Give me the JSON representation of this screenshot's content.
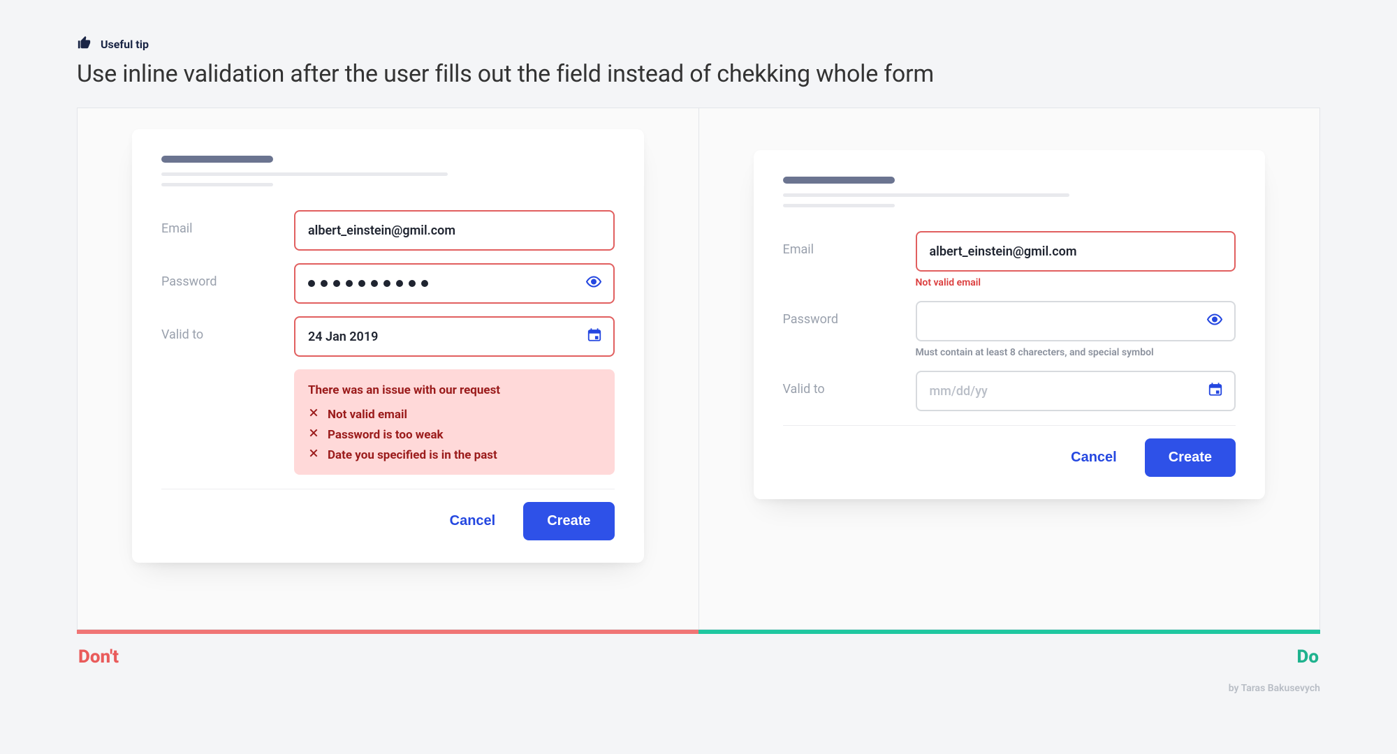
{
  "tip": {
    "label": "Useful tip"
  },
  "headline": "Use inline validation after the user fills out the field instead of chekking whole form",
  "form": {
    "labels": {
      "email": "Email",
      "password": "Password",
      "valid_to": "Valid to"
    },
    "buttons": {
      "cancel": "Cancel",
      "create": "Create"
    }
  },
  "dont": {
    "email": "albert_einstein@gmil.com",
    "valid_to": "24 Jan 2019",
    "error_title": "There was an issue with our request",
    "errors": [
      "Not valid email",
      "Password is too weak",
      "Date you specified is in the past"
    ]
  },
  "do": {
    "email": "albert_einstein@gmil.com",
    "email_error": "Not valid email",
    "password_help": "Must contain at least 8 charecters, and special symbol",
    "date_placeholder": "mm/dd/yy"
  },
  "verdict": {
    "dont": "Don't",
    "do": "Do"
  },
  "byline": "by Taras Bakusevych"
}
